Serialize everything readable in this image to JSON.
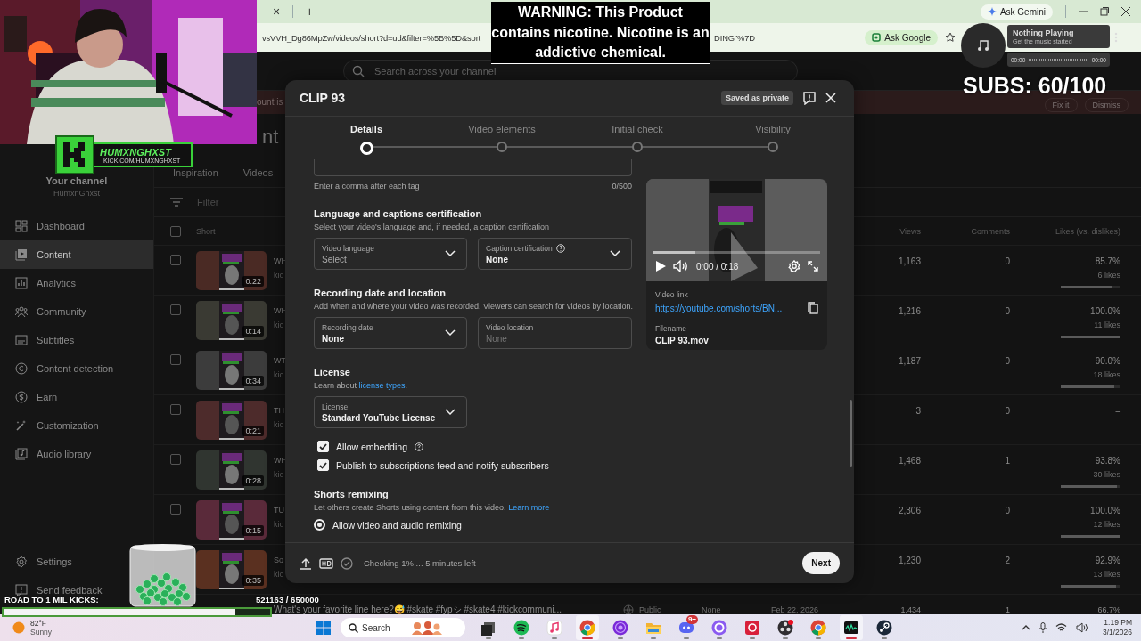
{
  "browser": {
    "tab_close": "×",
    "new_tab": "+",
    "ask_gemini": "Ask Gemini",
    "url": "vsVVH_Dg86MpZw/videos/short?d=ud&filter=%5B%5D&sort",
    "url_end": "DING\"%7D",
    "ask_google": "Ask Google"
  },
  "studio": {
    "search": {
      "placeholder": "Search across your channel"
    },
    "banner": {
      "text": "ount is",
      "buttons": [
        "Fix it",
        "Dismiss"
      ]
    },
    "heading": "nt",
    "channel": {
      "label": "Your channel",
      "name": "HumxnGhxst"
    },
    "sidebar": {
      "items": [
        {
          "label": "Dashboard",
          "selected": false
        },
        {
          "label": "Content",
          "selected": true
        },
        {
          "label": "Analytics",
          "selected": false
        },
        {
          "label": "Community",
          "selected": false
        },
        {
          "label": "Subtitles",
          "selected": false
        },
        {
          "label": "Content detection",
          "selected": false
        },
        {
          "label": "Earn",
          "selected": false
        },
        {
          "label": "Customization",
          "selected": false
        },
        {
          "label": "Audio library",
          "selected": false
        }
      ],
      "footer": [
        "Settings",
        "Send feedback"
      ]
    },
    "content_tabs": [
      {
        "label": "Inspiration",
        "selected": false
      },
      {
        "label": "Videos",
        "selected": false
      }
    ],
    "filter": {
      "placeholder": "Filter"
    },
    "table": {
      "all_checked": false,
      "columns": [
        "Short",
        "Views",
        "Comments",
        "Likes (vs. dislikes)"
      ],
      "rows": [
        {
          "checked": false,
          "duration": "0:22",
          "title": "WH",
          "subtitle": "kic",
          "views": "1,163",
          "comments": "0",
          "likes": "85.7%",
          "likes_count": "6 likes",
          "level": 0.857
        },
        {
          "checked": false,
          "duration": "0:14",
          "title": "WH",
          "subtitle": "kic",
          "views": "1,216",
          "comments": "0",
          "likes": "100.0%",
          "likes_count": "11 likes",
          "level": 1.0
        },
        {
          "checked": false,
          "duration": "0:34",
          "title": "WT",
          "subtitle": "kic",
          "views": "1,187",
          "comments": "0",
          "likes": "90.0%",
          "likes_count": "18 likes",
          "level": 0.9
        },
        {
          "checked": false,
          "duration": "0:21",
          "title": "TH",
          "subtitle": "kic",
          "views": "3",
          "comments": "0",
          "likes": "–"
        },
        {
          "checked": false,
          "duration": "0:28",
          "title": "WH",
          "subtitle": "kic",
          "views": "1,468",
          "comments": "1",
          "likes": "93.8%",
          "likes_count": "30 likes",
          "level": 0.938
        },
        {
          "checked": false,
          "duration": "0:15",
          "title": "TU",
          "subtitle": "kic",
          "views": "2,306",
          "comments": "0",
          "likes": "100.0%",
          "likes_count": "12 likes",
          "level": 1.0
        },
        {
          "duration": "0:35",
          "title": "So",
          "subtitle": "kic",
          "views": "1,230",
          "comments": "2",
          "likes": "92.9%",
          "likes_count": "13 likes",
          "level": 0.929
        },
        {
          "title": "What's your favorite line here?😅 #skate #fypシ #skate4 #kickcommuni...",
          "visibility": "Public",
          "restrictions": "None",
          "date": "Feb 22, 2026",
          "views": "1,434",
          "comments": "1",
          "likes": "66.7%"
        }
      ]
    }
  },
  "modal": {
    "title": "CLIP 93",
    "status": "Saved as private",
    "steps": [
      {
        "label": "Details",
        "selected": true
      },
      {
        "label": "Video elements",
        "selected": false
      },
      {
        "label": "Initial check",
        "selected": false
      },
      {
        "label": "Visibility",
        "selected": false
      }
    ],
    "tags": {
      "hint": "Enter a comma after each tag",
      "count": "0/500"
    },
    "sections": [
      {
        "kind": "fields",
        "title": "Language and captions certification",
        "description": "Select your video's language and, if needed, a caption certification",
        "fields": [
          {
            "kind": "dropdown",
            "label": "Video language",
            "placeholder": "Select",
            "help": false
          },
          {
            "kind": "dropdown",
            "label": "Caption certification",
            "value": "None",
            "help": true
          }
        ]
      },
      {
        "kind": "fields",
        "title": "Recording date and location",
        "description": "Add when and where your video was recorded. Viewers can search for videos by location.",
        "fields": [
          {
            "kind": "dropdown",
            "label": "Recording date",
            "value": "None",
            "help": false
          },
          {
            "kind": "text",
            "label": "Video location",
            "placeholder": "None",
            "help": false
          }
        ]
      },
      {
        "kind": "fields",
        "title": "License",
        "description": "Learn about ",
        "link": "license types",
        "description_end": ".",
        "fields": [
          {
            "kind": "dropdown",
            "label": "License",
            "value": "Standard YouTube License",
            "help": false
          }
        ]
      },
      {
        "kind": "checkboxes",
        "items": [
          {
            "label": "Allow embedding",
            "checked": true,
            "help": true
          },
          {
            "label": "Publish to subscriptions feed and notify subscribers",
            "checked": true,
            "help": false
          }
        ]
      },
      {
        "kind": "radios",
        "title": "Shorts remixing",
        "description": "Let others create Shorts using content from this video. ",
        "link": "Learn more",
        "items": [
          {
            "label": "Allow video and audio remixing",
            "selected": true
          }
        ]
      }
    ],
    "preview": {
      "time": "0:00 / 0:18",
      "level": 0.25,
      "link_label": "Video link",
      "link": "https://youtube.com/shorts/BN...",
      "filename_label": "Filename",
      "filename": "CLIP 93.mov"
    },
    "footer": {
      "status": "Checking 1% ... 5 minutes left",
      "next": "Next"
    }
  },
  "overlay": {
    "warning": "WARNING: This Product contains nicotine. Nicotine is an addictive chemical.",
    "subs": "SUBS: 60/100",
    "logo": {
      "name": "HUMXNGHXST",
      "url": "KICK.COM/HUMXNGHXST"
    },
    "music": {
      "title": "Nothing Playing",
      "subtitle": "Get the music started",
      "start": "00:00",
      "end": "00:00"
    },
    "kicks": {
      "label": "ROAD TO 1 MIL KICKS:",
      "count": "521163 / 650000",
      "level": 0.87
    }
  },
  "taskbar": {
    "weather": {
      "temp": "82°F",
      "condition": "Sunny"
    },
    "search": {
      "placeholder": "Search"
    },
    "apps": [
      {
        "kind": "stack",
        "active": false
      },
      {
        "kind": "waves",
        "active": false
      },
      {
        "kind": "note",
        "active": false
      },
      {
        "kind": "browser",
        "active": true
      },
      {
        "kind": "orb",
        "active": false
      },
      {
        "kind": "folder",
        "active": false
      },
      {
        "kind": "chat",
        "active": false,
        "badge": "9+"
      },
      {
        "kind": "ring",
        "active": false
      },
      {
        "kind": "record",
        "active": false
      },
      {
        "kind": "dots",
        "active": false
      },
      {
        "kind": "browser",
        "active": false
      },
      {
        "kind": "monitor",
        "active": true
      },
      {
        "kind": "steam",
        "active": false
      }
    ],
    "clock": {
      "time": "1:19 PM",
      "date": "3/1/2026"
    }
  }
}
